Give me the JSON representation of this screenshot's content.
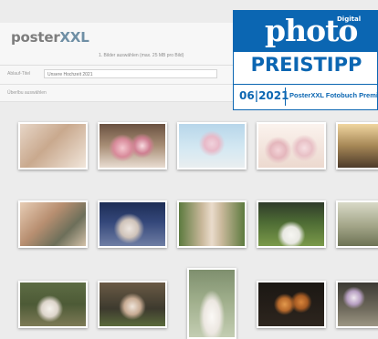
{
  "app": {
    "logo_part1": "poster",
    "logo_part2": "XXL"
  },
  "upload": {
    "step_text": "1. Bilder auswählen (max. 25 MB pro Bild)"
  },
  "title_row": {
    "label": "Ablauf-Titel",
    "value": "Unsere Hochzeit 2021"
  },
  "action_row": {
    "text": "Überlbu auswählen"
  },
  "badge": {
    "digital": "Digital",
    "word": "photo",
    "title": "PREISTIPP",
    "issue": "06|2021",
    "product": "PosterXXL Fotobuch Premium"
  },
  "gallery": {
    "photos": [
      {
        "name": "hands-heart-photo"
      },
      {
        "name": "table-flowers-photo"
      },
      {
        "name": "wedding-arch-photo"
      },
      {
        "name": "baby-flowers-photo"
      },
      {
        "name": "couple-sunset-photo"
      },
      {
        "name": "rings-hands-photo"
      },
      {
        "name": "couple-bed-photo"
      },
      {
        "name": "ceremony-aisle-photo"
      },
      {
        "name": "bride-field-photo"
      },
      {
        "name": "bride-lake-photo"
      },
      {
        "name": "bride-bouquet-photo"
      },
      {
        "name": "couple-kiss-photo"
      },
      {
        "name": "bride-portrait-photo"
      },
      {
        "name": "roses-dark-photo"
      },
      {
        "name": "flower-jar-photo"
      }
    ]
  }
}
